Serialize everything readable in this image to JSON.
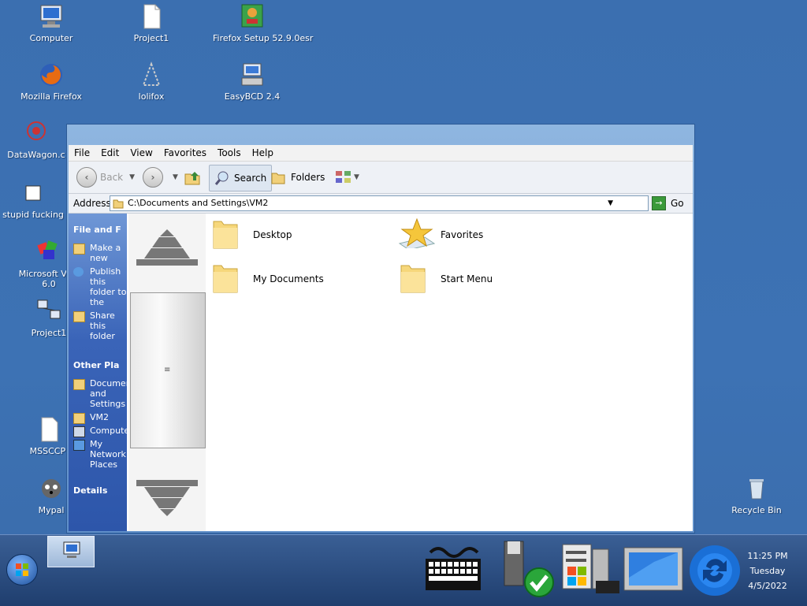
{
  "desktop_icons": [
    {
      "label": "Computer"
    },
    {
      "label": "Project1"
    },
    {
      "label": "Firefox Setup 52.9.0esr"
    },
    {
      "label": "Mozilla Firefox"
    },
    {
      "label": "lolifox"
    },
    {
      "label": "EasyBCD 2.4"
    },
    {
      "label": "DataWagon.c"
    },
    {
      "label": "stupid fucking"
    },
    {
      "label": "Microsoft Visu"
    },
    {
      "label": "6.0"
    },
    {
      "label": "Project1"
    },
    {
      "label": "MSSCCPI"
    },
    {
      "label": "Mypal"
    },
    {
      "label": "Recycle Bin"
    }
  ],
  "menu": [
    "File",
    "Edit",
    "View",
    "Favorites",
    "Tools",
    "Help"
  ],
  "toolbar": {
    "back": "Back",
    "search": "Search",
    "folders": "Folders"
  },
  "address": {
    "label": "Address",
    "value": "C:\\Documents and Settings\\VM2",
    "go": "Go"
  },
  "taskpane": {
    "file_head": "File and F",
    "file_items": [
      "Make a new",
      "Publish this folder to the",
      "Share this folder"
    ],
    "other_head": "Other Pla",
    "other_items": [
      "Documents and Settings",
      "VM2",
      "Computer",
      "My Network Places"
    ],
    "details_head": "Details"
  },
  "items": [
    {
      "name": "Desktop"
    },
    {
      "name": "Favorites"
    },
    {
      "name": "My Documents"
    },
    {
      "name": "Start Menu"
    }
  ],
  "clock": {
    "time": "11:25 PM",
    "day": "Tuesday",
    "date": "4/5/2022"
  }
}
